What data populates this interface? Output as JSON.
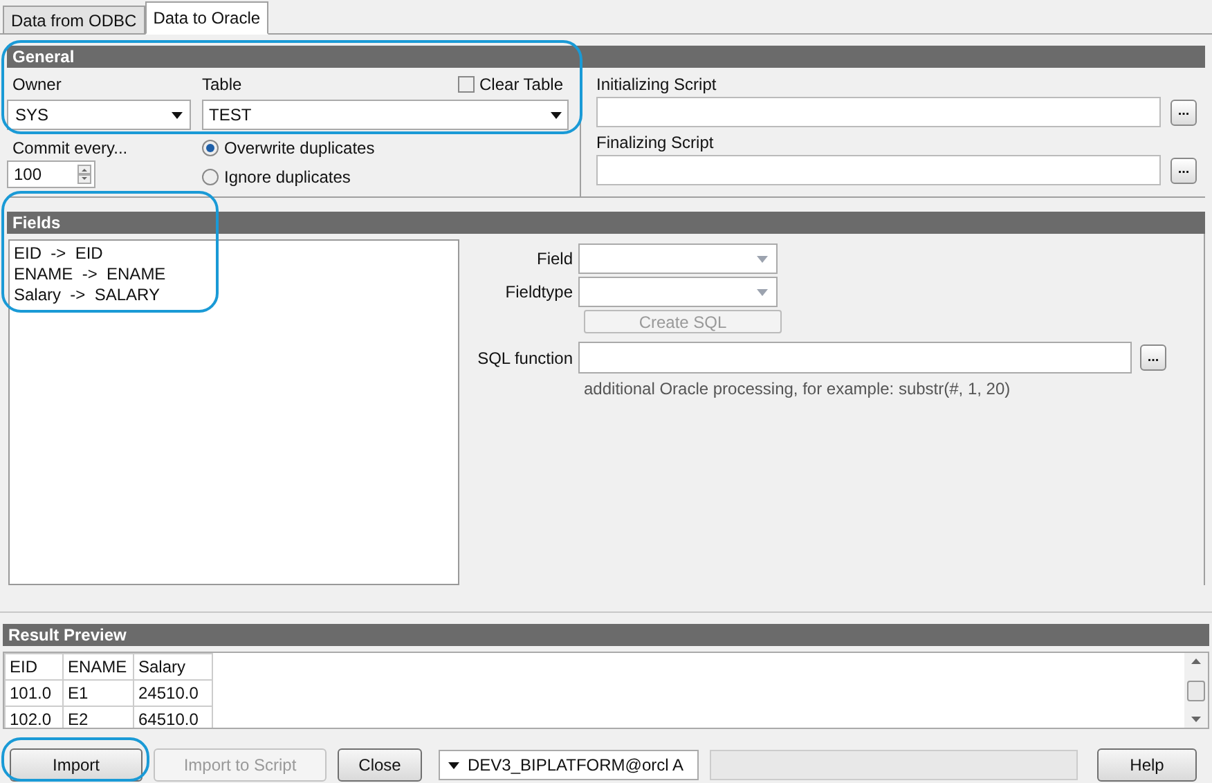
{
  "tabs": [
    {
      "label": "Data from ODBC",
      "selected": false
    },
    {
      "label": "Data to Oracle",
      "selected": true
    }
  ],
  "general": {
    "title": "General",
    "owner": {
      "label": "Owner",
      "value": "SYS"
    },
    "table": {
      "label": "Table",
      "value": "TEST"
    },
    "clear_table": {
      "label": "Clear Table",
      "checked": false
    },
    "commit": {
      "label": "Commit every...",
      "value": "100"
    },
    "duplicates": [
      {
        "label": "Overwrite duplicates",
        "selected": true
      },
      {
        "label": "Ignore duplicates",
        "selected": false
      }
    ],
    "scripts": [
      {
        "label": "Initializing Script",
        "button": "..."
      },
      {
        "label": "Finalizing Script",
        "button": "..."
      }
    ]
  },
  "fields": {
    "title": "Fields",
    "mappings": [
      "EID  ->  EID",
      "ENAME  ->  ENAME",
      "Salary  ->  SALARY"
    ],
    "field": {
      "label": "Field"
    },
    "fieldtype": {
      "label": "Fieldtype"
    },
    "create_sql": {
      "label": "Create SQL",
      "disabled": true
    },
    "sql_function": {
      "label": "SQL function",
      "button": "..."
    },
    "hint": "additional Oracle processing, for example: substr(#, 1, 20)"
  },
  "result_preview": {
    "title": "Result Preview",
    "columns": [
      "EID",
      "ENAME",
      "Salary"
    ],
    "rows": [
      [
        "101.0",
        "E1",
        "24510.0"
      ],
      [
        "102.0",
        "E2",
        "64510.0"
      ]
    ]
  },
  "buttons": [
    {
      "label": "Import",
      "disabled": false
    },
    {
      "label": "Import to Script",
      "disabled": true
    },
    {
      "label": "Close",
      "disabled": false
    }
  ],
  "connection": "DEV3_BIPLATFORM@orcl A",
  "help": "Help"
}
